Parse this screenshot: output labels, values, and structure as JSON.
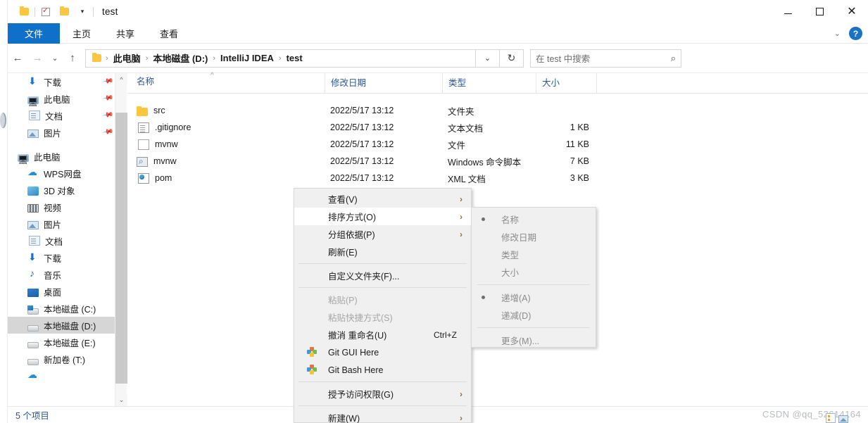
{
  "window": {
    "title": "test",
    "quick_access": {
      "folder_icon": "folder-icon",
      "checkbox_icon": "checkbox-icon",
      "folder_icon_2": "folder-icon",
      "dropdown_icon": "chevron-down-icon"
    },
    "controls": {
      "minimize": "minimize-icon",
      "maximize": "maximize-icon",
      "close": "close-icon",
      "ribbon_collapse": "chevron-down-icon",
      "help": "?"
    }
  },
  "ribbon": {
    "tabs": [
      {
        "label": "文件",
        "active": true
      },
      {
        "label": "主页",
        "active": false
      },
      {
        "label": "共享",
        "active": false
      },
      {
        "label": "查看",
        "active": false
      }
    ]
  },
  "address": {
    "back_icon": "back-arrow-icon",
    "forward_icon": "forward-arrow-icon",
    "recent_icon": "chevron-down-icon",
    "up_icon": "up-arrow-icon",
    "breadcrumbs": [
      "此电脑",
      "本地磁盘 (D:)",
      "IntelliJ IDEA",
      "test"
    ],
    "separator": "›",
    "dropdown_icon": "chevron-down-icon",
    "refresh_icon": "refresh-icon"
  },
  "search": {
    "placeholder": "在 test 中搜索",
    "icon": "search-icon"
  },
  "navpane": {
    "quick_items": [
      {
        "label": "下载",
        "icon": "download-icon",
        "pinned": true
      },
      {
        "label": "此电脑",
        "icon": "computer-icon",
        "pinned": true
      },
      {
        "label": "文档",
        "icon": "documents-icon",
        "pinned": true
      },
      {
        "label": "图片",
        "icon": "pictures-icon",
        "pinned": true
      }
    ],
    "this_pc": {
      "label": "此电脑",
      "icon": "computer-icon"
    },
    "pc_items": [
      {
        "label": "WPS网盘",
        "icon": "cloud-icon",
        "selected": false
      },
      {
        "label": "3D 对象",
        "icon": "3d-objects-icon",
        "selected": false
      },
      {
        "label": "视频",
        "icon": "videos-icon",
        "selected": false
      },
      {
        "label": "图片",
        "icon": "pictures-icon",
        "selected": false
      },
      {
        "label": "文档",
        "icon": "documents-icon",
        "selected": false
      },
      {
        "label": "下载",
        "icon": "download-icon",
        "selected": false
      },
      {
        "label": "音乐",
        "icon": "music-icon",
        "selected": false
      },
      {
        "label": "桌面",
        "icon": "desktop-icon",
        "selected": false
      },
      {
        "label": "本地磁盘 (C:)",
        "icon": "windows-drive-icon",
        "selected": false
      },
      {
        "label": "本地磁盘 (D:)",
        "icon": "drive-icon",
        "selected": true
      },
      {
        "label": "本地磁盘 (E:)",
        "icon": "drive-icon",
        "selected": false
      },
      {
        "label": "新加卷 (T:)",
        "icon": "drive-icon",
        "selected": false
      }
    ],
    "scrollbar": {
      "up_icon": "chevron-up-icon",
      "down_icon": "chevron-down-icon"
    }
  },
  "filelist": {
    "columns": [
      "名称",
      "修改日期",
      "类型",
      "大小"
    ],
    "sort_indicator": "ascending",
    "rows": [
      {
        "name": "src",
        "icon": "folder-icon",
        "date": "2022/5/17 13:12",
        "type": "文件夹",
        "size": ""
      },
      {
        "name": ".gitignore",
        "icon": "text-file-icon",
        "date": "2022/5/17 13:12",
        "type": "文本文档",
        "size": "1 KB"
      },
      {
        "name": "mvnw",
        "icon": "blank-file-icon",
        "date": "2022/5/17 13:12",
        "type": "文件",
        "size": "11 KB"
      },
      {
        "name": "mvnw",
        "icon": "cmd-script-icon",
        "date": "2022/5/17 13:12",
        "type": "Windows 命令脚本",
        "size": "7 KB"
      },
      {
        "name": "pom",
        "icon": "xml-file-icon",
        "date": "2022/5/17 13:12",
        "type": "XML 文档",
        "size": "3 KB"
      }
    ]
  },
  "statusbar": {
    "text": "5 个项目"
  },
  "context_menu": {
    "items": [
      {
        "label": "查看(V)",
        "submenu": true,
        "disabled": false,
        "highlighted": false,
        "accel": "",
        "icon": ""
      },
      {
        "label": "排序方式(O)",
        "submenu": true,
        "disabled": false,
        "highlighted": true,
        "accel": "",
        "icon": ""
      },
      {
        "label": "分组依据(P)",
        "submenu": true,
        "disabled": false,
        "highlighted": false,
        "accel": "",
        "icon": ""
      },
      {
        "label": "刷新(E)",
        "submenu": false,
        "disabled": false,
        "highlighted": false,
        "accel": "",
        "icon": ""
      },
      {
        "separator": true
      },
      {
        "label": "自定义文件夹(F)...",
        "submenu": false,
        "disabled": false,
        "highlighted": false,
        "accel": "",
        "icon": ""
      },
      {
        "separator": true
      },
      {
        "label": "粘贴(P)",
        "submenu": false,
        "disabled": true,
        "highlighted": false,
        "accel": "",
        "icon": ""
      },
      {
        "label": "粘贴快捷方式(S)",
        "submenu": false,
        "disabled": true,
        "highlighted": false,
        "accel": "",
        "icon": ""
      },
      {
        "label": "撤消 重命名(U)",
        "submenu": false,
        "disabled": false,
        "highlighted": false,
        "accel": "Ctrl+Z",
        "icon": ""
      },
      {
        "label": "Git GUI Here",
        "submenu": false,
        "disabled": false,
        "highlighted": false,
        "accel": "",
        "icon": "git-icon"
      },
      {
        "label": "Git Bash Here",
        "submenu": false,
        "disabled": false,
        "highlighted": false,
        "accel": "",
        "icon": "git-icon"
      },
      {
        "separator": true
      },
      {
        "label": "授予访问权限(G)",
        "submenu": true,
        "disabled": false,
        "highlighted": false,
        "accel": "",
        "icon": ""
      },
      {
        "separator": true
      },
      {
        "label": "新建(W)",
        "submenu": true,
        "disabled": false,
        "highlighted": false,
        "accel": "",
        "icon": ""
      }
    ]
  },
  "submenu": {
    "items": [
      {
        "label": "名称",
        "checked": true
      },
      {
        "label": "修改日期",
        "checked": false
      },
      {
        "label": "类型",
        "checked": false
      },
      {
        "label": "大小",
        "checked": false
      },
      {
        "separator": true
      },
      {
        "label": "递增(A)",
        "checked": true
      },
      {
        "label": "递减(D)",
        "checked": false
      },
      {
        "separator": true
      },
      {
        "label": "更多(M)...",
        "checked": false
      }
    ]
  },
  "watermark": {
    "text": "CSDN @qq_52614164"
  },
  "colors": {
    "accent": "#0f70c9",
    "header_text": "#2b579a",
    "selection": "#d6d6d6",
    "menu_bg": "#f0f0f0"
  }
}
